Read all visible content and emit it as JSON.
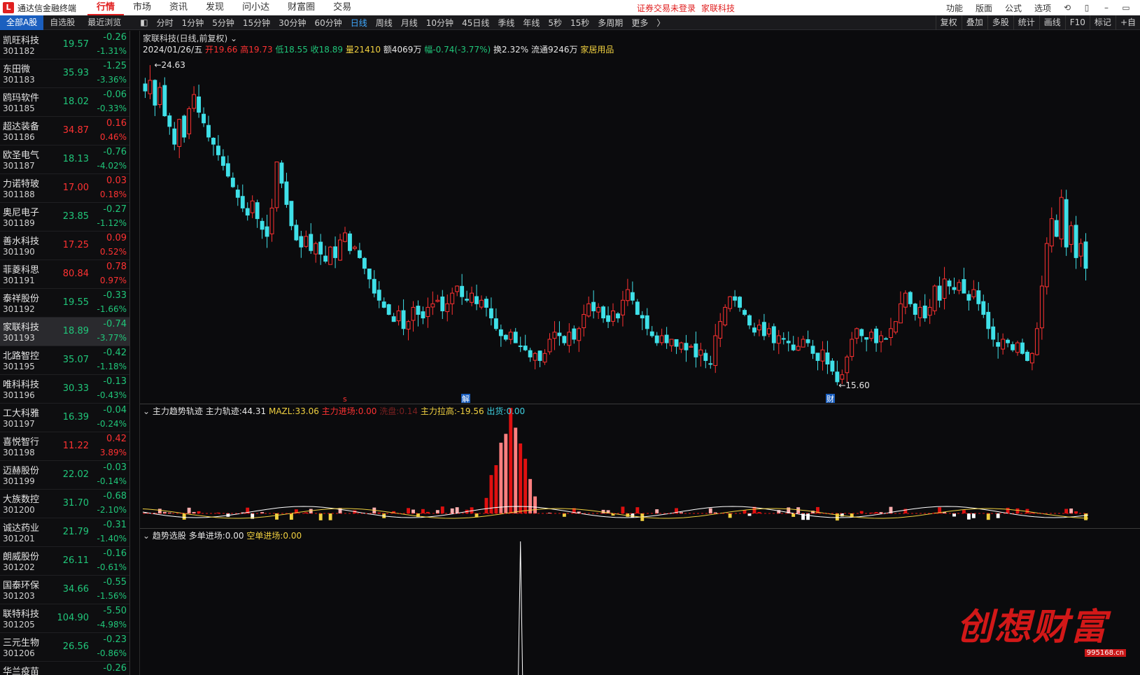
{
  "app": {
    "title": "通达信金融终端",
    "menus": [
      "行情",
      "市场",
      "资讯",
      "发现",
      "问小达",
      "财富圈",
      "交易"
    ],
    "login_status": "证券交易未登录",
    "login_stock": "家联科技",
    "right_menus": [
      "功能",
      "版面",
      "公式",
      "选项"
    ]
  },
  "toolbar": {
    "list_tabs": [
      "全部A股",
      "自选股",
      "最近浏览"
    ],
    "periods": [
      "分时",
      "1分钟",
      "5分钟",
      "15分钟",
      "30分钟",
      "60分钟",
      "日线",
      "周线",
      "月线",
      "10分钟",
      "45日线",
      "季线",
      "年线",
      "5秒",
      "15秒",
      "多周期",
      "更多"
    ],
    "active_period": "日线",
    "right_tools": [
      "复权",
      "叠加",
      "多股",
      "统计",
      "画线",
      "F10",
      "标记",
      "+自"
    ]
  },
  "stocks": [
    {
      "name": "凯旺科技",
      "code": "301182",
      "price": "19.57",
      "change": "-0.26",
      "pct": "-1.31%",
      "dir": "down"
    },
    {
      "name": "东田微",
      "code": "301183",
      "price": "35.93",
      "change": "-1.25",
      "pct": "-3.36%",
      "dir": "down"
    },
    {
      "name": "鸥玛软件",
      "code": "301185",
      "price": "18.02",
      "change": "-0.06",
      "pct": "-0.33%",
      "dir": "down"
    },
    {
      "name": "超达装备",
      "code": "301186",
      "price": "34.87",
      "change": "0.16",
      "pct": "0.46%",
      "dir": "up"
    },
    {
      "name": "欧圣电气",
      "code": "301187",
      "price": "18.13",
      "change": "-0.76",
      "pct": "-4.02%",
      "dir": "down"
    },
    {
      "name": "力诺特玻",
      "code": "301188",
      "price": "17.00",
      "change": "0.03",
      "pct": "0.18%",
      "dir": "up"
    },
    {
      "name": "奥尼电子",
      "code": "301189",
      "price": "23.85",
      "change": "-0.27",
      "pct": "-1.12%",
      "dir": "down"
    },
    {
      "name": "善水科技",
      "code": "301190",
      "price": "17.25",
      "change": "0.09",
      "pct": "0.52%",
      "dir": "up"
    },
    {
      "name": "菲菱科思",
      "code": "301191",
      "price": "80.84",
      "change": "0.78",
      "pct": "0.97%",
      "dir": "up"
    },
    {
      "name": "泰祥股份",
      "code": "301192",
      "price": "19.55",
      "change": "-0.33",
      "pct": "-1.66%",
      "dir": "down"
    },
    {
      "name": "家联科技",
      "code": "301193",
      "price": "18.89",
      "change": "-0.74",
      "pct": "-3.77%",
      "dir": "down"
    },
    {
      "name": "北路智控",
      "code": "301195",
      "price": "35.07",
      "change": "-0.42",
      "pct": "-1.18%",
      "dir": "down"
    },
    {
      "name": "唯科科技",
      "code": "301196",
      "price": "30.33",
      "change": "-0.13",
      "pct": "-0.43%",
      "dir": "down"
    },
    {
      "name": "工大科雅",
      "code": "301197",
      "price": "16.39",
      "change": "-0.04",
      "pct": "-0.24%",
      "dir": "down"
    },
    {
      "name": "喜悦智行",
      "code": "301198",
      "price": "11.22",
      "change": "0.42",
      "pct": "3.89%",
      "dir": "up"
    },
    {
      "name": "迈赫股份",
      "code": "301199",
      "price": "22.02",
      "change": "-0.03",
      "pct": "-0.14%",
      "dir": "down"
    },
    {
      "name": "大族数控",
      "code": "301200",
      "price": "31.70",
      "change": "-0.68",
      "pct": "-2.10%",
      "dir": "down"
    },
    {
      "name": "诚达药业",
      "code": "301201",
      "price": "21.79",
      "change": "-0.31",
      "pct": "-1.40%",
      "dir": "down"
    },
    {
      "name": "朗威股份",
      "code": "301202",
      "price": "26.11",
      "change": "-0.16",
      "pct": "-0.61%",
      "dir": "down"
    },
    {
      "name": "国泰环保",
      "code": "301203",
      "price": "34.66",
      "change": "-0.55",
      "pct": "-1.56%",
      "dir": "down"
    },
    {
      "name": "联特科技",
      "code": "301205",
      "price": "104.90",
      "change": "-5.50",
      "pct": "-4.98%",
      "dir": "down"
    },
    {
      "name": "三元生物",
      "code": "301206",
      "price": "26.56",
      "change": "-0.23",
      "pct": "-0.86%",
      "dir": "down"
    },
    {
      "name": "华兰疫苗",
      "code": "",
      "price": "",
      "change": "-0.26",
      "pct": "",
      "dir": "down"
    }
  ],
  "chart": {
    "title": "家联科技(日线,前复权)",
    "date": "2024/01/26/五",
    "open_label": "开",
    "open": "19.66",
    "high_label": "高",
    "high": "19.73",
    "low_label": "低",
    "low": "18.55",
    "close_label": "收",
    "close": "18.89",
    "volume_label": "量",
    "volume": "21410",
    "amount_label": "额",
    "amount": "4069万",
    "range_label": "幅",
    "range": "-0.74(-3.77%)",
    "turnover_label": "换",
    "turnover": "2.32%",
    "float_label": "流通",
    "float": "9246万",
    "sector": "家居用品",
    "max_label": "24.63",
    "min_label": "15.60",
    "marker_jie": "解",
    "marker_cai": "财",
    "marker_s": "s"
  },
  "indicator1": {
    "name": "主力趋势轨迹",
    "track_label": "主力轨迹:",
    "track_value": "44.31",
    "mazl_label": "MAZL:",
    "mazl_value": "33.06",
    "enter_label": "主力进场:",
    "enter_value": "0.00",
    "wash_label": "洗盘:",
    "wash_value": "0.14",
    "pull_label": "主力拉高:",
    "pull_value": "-19.56",
    "out_label": "出货:",
    "out_value": "0.00"
  },
  "indicator2": {
    "name": "趋势选股",
    "long_label": "多单进场:",
    "long_value": "0.00",
    "short_label": "空单进场:",
    "short_value": "0.00"
  },
  "watermark": {
    "text": "创想财富",
    "url": "995168.cn"
  },
  "colors": {
    "up": "#ff3232",
    "down": "#20c67a",
    "candle_down": "#3fe0e8",
    "accent": "#1b5fbf"
  },
  "chart_data": {
    "type": "candlestick",
    "title": "家联科技(日线,前复权)",
    "ylim": [
      15.6,
      24.63
    ],
    "close_series": [
      23.9,
      24.2,
      23.5,
      24.0,
      23.2,
      22.9,
      22.4,
      23.1,
      22.6,
      23.4,
      23.8,
      23.3,
      23.0,
      22.6,
      22.4,
      22.1,
      21.8,
      21.5,
      21.2,
      20.9,
      20.6,
      20.4,
      20.8,
      20.3,
      20.0,
      19.8,
      20.6,
      21.9,
      21.3,
      20.7,
      20.1,
      19.7,
      19.5,
      19.8,
      19.4,
      19.6,
      19.3,
      19.1,
      19.5,
      19.2,
      19.7,
      19.9,
      19.4,
      19.5,
      19.2,
      18.9,
      18.6,
      18.2,
      18.0,
      17.8,
      17.6,
      17.4,
      17.7,
      17.2,
      17.4,
      17.8,
      17.6,
      17.5,
      17.8,
      17.9,
      18.0,
      17.7,
      17.9,
      18.2,
      18.4,
      18.1,
      18.0,
      18.2,
      17.9,
      18.0,
      17.8,
      17.5,
      17.2,
      17.0,
      16.9,
      17.1,
      16.8,
      16.7,
      16.6,
      16.4,
      16.5,
      16.3,
      16.5,
      16.9,
      17.1,
      17.0,
      16.8,
      17.1,
      16.9,
      17.2,
      17.6,
      17.9,
      17.7,
      17.8,
      17.5,
      17.4,
      17.7,
      17.5,
      18.0,
      18.3,
      18.0,
      17.6,
      17.5,
      17.2,
      17.0,
      16.8,
      17.0,
      16.8,
      16.9,
      16.7,
      16.8,
      16.6,
      16.7,
      16.4,
      16.6,
      16.3,
      16.2,
      17.0,
      17.4,
      17.8,
      18.1,
      18.0,
      17.8,
      17.6,
      17.3,
      17.1,
      17.3,
      17.0,
      17.2,
      16.8,
      17.0,
      16.9,
      16.8,
      16.6,
      16.7,
      16.9,
      16.8,
      16.5,
      16.3,
      16.6,
      16.2,
      16.0,
      15.7,
      15.9,
      16.4,
      16.9,
      17.2,
      17.0,
      16.9,
      17.1,
      16.8,
      17.0,
      16.9,
      17.2,
      17.4,
      17.9,
      18.2,
      17.9,
      17.6,
      17.8,
      17.5,
      17.8,
      18.4,
      18.0,
      18.6,
      18.4,
      18.3,
      18.5,
      18.2,
      18.0,
      18.3,
      17.9,
      17.6,
      17.2,
      16.9,
      16.7,
      16.9,
      16.8,
      16.6,
      16.8,
      16.5,
      16.3,
      16.5,
      17.2,
      18.4,
      19.6,
      20.3,
      19.8,
      20.9,
      19.5,
      20.1,
      19.2,
      19.6,
      18.9
    ]
  }
}
